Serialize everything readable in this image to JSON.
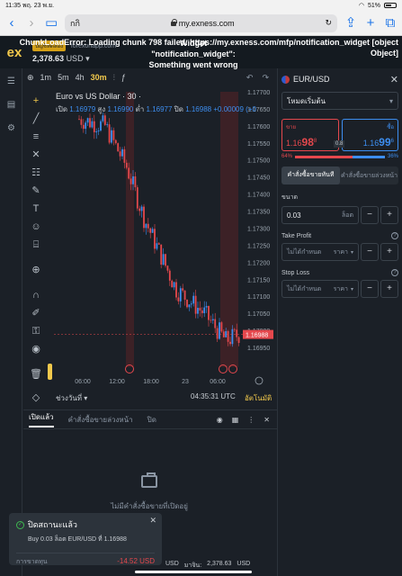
{
  "ios": {
    "time": "11:35",
    "date": "พฤ. 23 พ.ย.",
    "battery": "51%"
  },
  "browser": {
    "tab_label": "กกิ",
    "url": "my.exness.com"
  },
  "header": {
    "account_badge": "บัญชีทดลอง",
    "account_domain": "forexonapp.com",
    "balance": "2,378.63",
    "currency": "USD",
    "error_widget": "Widget \"notification_widget\": Something went wrong",
    "error_chunk": "ChunkLoadError: Loading chunk 798 failed. https://my.exness.com/mfp/notification_widget [object Object]"
  },
  "chart": {
    "timeframes": [
      "1m",
      "5m",
      "4h",
      "30m"
    ],
    "active_timeframe": "30m",
    "title": "Euro vs US Dollar · 30 ·",
    "ohlc": {
      "open_label": "เปิด",
      "open": "1.16979",
      "high_label": "สูง",
      "high": "1.16990",
      "low_label": "ต่ำ",
      "low": "1.16977",
      "close_label": "ปิด",
      "close": "1.16988",
      "change": "+0.00009 (+0"
    },
    "price_labels": [
      "1.17700",
      "1.17650",
      "1.17600",
      "1.17550",
      "1.17500",
      "1.17450",
      "1.17400",
      "1.17350",
      "1.17300",
      "1.17250",
      "1.17200",
      "1.17150",
      "1.17100",
      "1.17050",
      "1.17000",
      "1.16950"
    ],
    "current_price": "1.16988",
    "time_labels": [
      "06:00",
      "12:00",
      "18:00",
      "23",
      "06:00"
    ],
    "date_range": "ช่วงวันที่",
    "clock": "04:35:31 UTC",
    "auto": "อัตโนมัติ",
    "colors": {
      "up": "#3d8ef0",
      "down": "#e5484d"
    }
  },
  "order": {
    "symbol": "EUR/USD",
    "mode": "โหมดเริ่มต้น",
    "sell_label": "ขาย",
    "sell_price_main": "1.16",
    "sell_price_big": "98",
    "sell_price_sup": "8",
    "buy_label": "ซื้อ",
    "buy_price_main": "1.16",
    "buy_price_big": "99",
    "buy_price_sup": "6",
    "spread": "0.8",
    "sell_pct": "64%",
    "buy_pct": "36%",
    "market_tab": "คำสั่งซื้อขายทันที",
    "pending_tab": "คำสั่งซื้อขายล่วงหน้า",
    "volume_label": "ขนาด",
    "volume_value": "0.03",
    "volume_unit": "ล็อต",
    "tp_label": "Take Profit",
    "tp_placeholder": "ไม่ได้กำหนด",
    "tp_unit": "ราคา",
    "sl_label": "Stop Loss",
    "sl_placeholder": "ไม่ได้กำหนด",
    "sl_unit": "ราคา"
  },
  "orders": {
    "tabs": [
      "เปิดแล้ว",
      "คำสั่งซื้อขายล่วงหน้า",
      "ปิด"
    ],
    "empty_text": "ไม่มีคำสั่งซื้อขายที่เปิดอยู่"
  },
  "toast": {
    "title": "ปิดสถานะแล้ว",
    "desc": "Buy 0.03 ล็อต EUR/USD ที่ 1.16988",
    "pl_label": "การขาดทุน",
    "pl_value": "-14.52 USD"
  },
  "footer": {
    "currency": "USD",
    "equity_label": "มาจิน:",
    "equity_value": "2,378.63",
    "equity_cur": "USD"
  }
}
